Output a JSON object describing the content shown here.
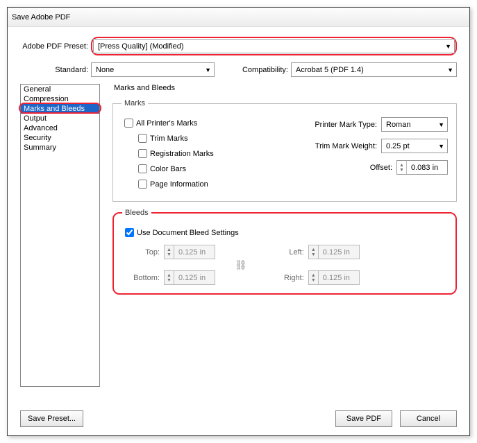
{
  "title": "Save Adobe PDF",
  "preset": {
    "label": "Adobe PDF Preset:",
    "value": "[Press Quality] (Modified)"
  },
  "standard": {
    "label": "Standard:",
    "value": "None"
  },
  "compatibility": {
    "label": "Compatibility:",
    "value": "Acrobat 5 (PDF 1.4)"
  },
  "sidebar": {
    "items": [
      "General",
      "Compression",
      "Marks and Bleeds",
      "Output",
      "Advanced",
      "Security",
      "Summary"
    ],
    "selected": "Marks and Bleeds"
  },
  "section_title": "Marks and Bleeds",
  "marks": {
    "legend": "Marks",
    "all": "All Printer's Marks",
    "trim": "Trim Marks",
    "registration": "Registration Marks",
    "colorbars": "Color Bars",
    "pageinfo": "Page Information",
    "printer_mark_type": {
      "label": "Printer Mark Type:",
      "value": "Roman"
    },
    "trim_mark_weight": {
      "label": "Trim Mark Weight:",
      "value": "0.25 pt"
    },
    "offset": {
      "label": "Offset:",
      "value": "0.083 in"
    }
  },
  "bleeds": {
    "legend": "Bleeds",
    "use_doc": "Use Document Bleed Settings",
    "top": {
      "label": "Top:",
      "value": "0.125 in"
    },
    "bottom": {
      "label": "Bottom:",
      "value": "0.125 in"
    },
    "left": {
      "label": "Left:",
      "value": "0.125 in"
    },
    "right": {
      "label": "Right:",
      "value": "0.125 in"
    }
  },
  "buttons": {
    "save_preset": "Save Preset...",
    "save_pdf": "Save PDF",
    "cancel": "Cancel"
  }
}
